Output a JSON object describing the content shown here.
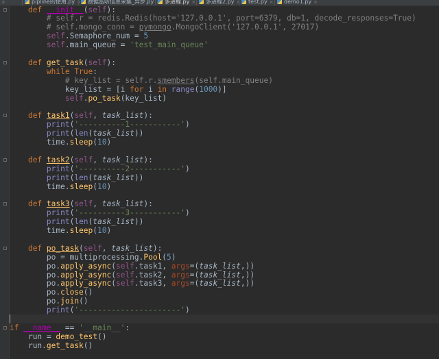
{
  "tabs": [
    {
      "label": "ly",
      "active": false
    },
    {
      "label": "pipline的使用.py",
      "active": false
    },
    {
      "label": "数据监听信息采集_异步.py",
      "active": false
    },
    {
      "label": "多进程.py",
      "active": true
    },
    {
      "label": "多进程2.py",
      "active": false
    },
    {
      "label": "test.py",
      "active": false
    },
    {
      "label": "demo1.py",
      "active": false
    }
  ],
  "tab_close_glyph": "×",
  "code_lines": [
    {
      "indent": "    ",
      "tokens": [
        [
          "kw",
          "def "
        ],
        [
          "magicu",
          "__init__"
        ],
        [
          "plain",
          "("
        ],
        [
          "self",
          "self"
        ],
        [
          "plain",
          "):"
        ]
      ]
    },
    {
      "indent": "        ",
      "tokens": [
        [
          "com",
          "# self.r = redis.Redis(host='127.0.0.1', port=6379, db=1, decode_responses=True)"
        ]
      ]
    },
    {
      "indent": "        ",
      "tokens": [
        [
          "com",
          "# self.mongo_conn = "
        ],
        [
          "comu",
          "pymongo"
        ],
        [
          "com",
          ".MongoClient('127.0.0.1', 27017)"
        ]
      ]
    },
    {
      "indent": "        ",
      "tokens": [
        [
          "self",
          "self"
        ],
        [
          "plain",
          ".Semaphore_num = "
        ],
        [
          "num",
          "5"
        ]
      ]
    },
    {
      "indent": "        ",
      "tokens": [
        [
          "self",
          "self"
        ],
        [
          "plain",
          ".main_queue = "
        ],
        [
          "str",
          "'test_main_queue'"
        ]
      ]
    },
    {
      "indent": "",
      "tokens": []
    },
    {
      "indent": "    ",
      "tokens": [
        [
          "kw",
          "def "
        ],
        [
          "fn",
          "get_task"
        ],
        [
          "plain",
          "("
        ],
        [
          "self",
          "self"
        ],
        [
          "plain",
          "):"
        ]
      ]
    },
    {
      "indent": "        ",
      "tokens": [
        [
          "kw",
          "while "
        ],
        [
          "kw",
          "True"
        ],
        [
          "plain",
          ":"
        ]
      ]
    },
    {
      "indent": "            ",
      "tokens": [
        [
          "com",
          "# key_list = self.r."
        ],
        [
          "comu",
          "smembers"
        ],
        [
          "com",
          "(self.main_queue)"
        ]
      ]
    },
    {
      "indent": "            ",
      "tokens": [
        [
          "plain",
          "key_list = [i "
        ],
        [
          "kw",
          "for "
        ],
        [
          "plain",
          "i "
        ],
        [
          "kw",
          "in "
        ],
        [
          "bi",
          "range"
        ],
        [
          "plain",
          "("
        ],
        [
          "num",
          "1000"
        ],
        [
          "plain",
          ")]"
        ]
      ]
    },
    {
      "indent": "            ",
      "tokens": [
        [
          "self",
          "self"
        ],
        [
          "plain",
          "."
        ],
        [
          "fn",
          "po_task"
        ],
        [
          "plain",
          "(key_list)"
        ]
      ]
    },
    {
      "indent": "",
      "tokens": []
    },
    {
      "indent": "    ",
      "tokens": [
        [
          "kw",
          "def "
        ],
        [
          "fnu",
          "task1"
        ],
        [
          "plain",
          "("
        ],
        [
          "self",
          "self"
        ],
        [
          "plain",
          ", "
        ],
        [
          "param",
          "task_list"
        ],
        [
          "plain",
          "):"
        ]
      ]
    },
    {
      "indent": "        ",
      "tokens": [
        [
          "bi",
          "print"
        ],
        [
          "plain",
          "("
        ],
        [
          "str",
          "'----------1-----------'"
        ],
        [
          "plain",
          ")"
        ]
      ]
    },
    {
      "indent": "        ",
      "tokens": [
        [
          "bi",
          "print"
        ],
        [
          "plain",
          "("
        ],
        [
          "bi",
          "len"
        ],
        [
          "plain",
          "("
        ],
        [
          "param",
          "task_list"
        ],
        [
          "plain",
          "))"
        ]
      ]
    },
    {
      "indent": "        ",
      "tokens": [
        [
          "plain",
          "time."
        ],
        [
          "fn",
          "sleep"
        ],
        [
          "plain",
          "("
        ],
        [
          "num",
          "10"
        ],
        [
          "plain",
          ")"
        ]
      ]
    },
    {
      "indent": "",
      "tokens": []
    },
    {
      "indent": "    ",
      "tokens": [
        [
          "kw",
          "def "
        ],
        [
          "fnu",
          "task2"
        ],
        [
          "plain",
          "("
        ],
        [
          "self",
          "self"
        ],
        [
          "plain",
          ", "
        ],
        [
          "param",
          "task_list"
        ],
        [
          "plain",
          "):"
        ]
      ]
    },
    {
      "indent": "        ",
      "tokens": [
        [
          "bi",
          "print"
        ],
        [
          "plain",
          "("
        ],
        [
          "str",
          "'----------2-----------'"
        ],
        [
          "plain",
          ")"
        ]
      ]
    },
    {
      "indent": "        ",
      "tokens": [
        [
          "bi",
          "print"
        ],
        [
          "plain",
          "("
        ],
        [
          "bi",
          "len"
        ],
        [
          "plain",
          "("
        ],
        [
          "param",
          "task_list"
        ],
        [
          "plain",
          "))"
        ]
      ]
    },
    {
      "indent": "        ",
      "tokens": [
        [
          "plain",
          "time."
        ],
        [
          "fn",
          "sleep"
        ],
        [
          "plain",
          "("
        ],
        [
          "num",
          "10"
        ],
        [
          "plain",
          ")"
        ]
      ]
    },
    {
      "indent": "",
      "tokens": []
    },
    {
      "indent": "    ",
      "tokens": [
        [
          "kw",
          "def "
        ],
        [
          "fnu",
          "task3"
        ],
        [
          "plain",
          "("
        ],
        [
          "self",
          "self"
        ],
        [
          "plain",
          ", "
        ],
        [
          "param",
          "task_list"
        ],
        [
          "plain",
          "):"
        ]
      ]
    },
    {
      "indent": "        ",
      "tokens": [
        [
          "bi",
          "print"
        ],
        [
          "plain",
          "("
        ],
        [
          "str",
          "'----------3-----------'"
        ],
        [
          "plain",
          ")"
        ]
      ]
    },
    {
      "indent": "        ",
      "tokens": [
        [
          "bi",
          "print"
        ],
        [
          "plain",
          "("
        ],
        [
          "bi",
          "len"
        ],
        [
          "plain",
          "("
        ],
        [
          "param",
          "task_list"
        ],
        [
          "plain",
          "))"
        ]
      ]
    },
    {
      "indent": "        ",
      "tokens": [
        [
          "plain",
          "time."
        ],
        [
          "fn",
          "sleep"
        ],
        [
          "plain",
          "("
        ],
        [
          "num",
          "10"
        ],
        [
          "plain",
          ")"
        ]
      ]
    },
    {
      "indent": "",
      "tokens": []
    },
    {
      "indent": "    ",
      "tokens": [
        [
          "kw",
          "def "
        ],
        [
          "fnu",
          "po_task"
        ],
        [
          "plain",
          "("
        ],
        [
          "self",
          "self"
        ],
        [
          "plain",
          ", "
        ],
        [
          "param",
          "task_list"
        ],
        [
          "plain",
          "):"
        ]
      ]
    },
    {
      "indent": "        ",
      "tokens": [
        [
          "plain",
          "po = multiprocessing."
        ],
        [
          "fn",
          "Pool"
        ],
        [
          "plain",
          "("
        ],
        [
          "num",
          "5"
        ],
        [
          "plain",
          ")"
        ]
      ]
    },
    {
      "indent": "        ",
      "tokens": [
        [
          "plain",
          "po."
        ],
        [
          "fn",
          "apply_async"
        ],
        [
          "plain",
          "("
        ],
        [
          "self",
          "self"
        ],
        [
          "plain",
          ".task1, "
        ],
        [
          "kwarg",
          "args"
        ],
        [
          "plain",
          "=("
        ],
        [
          "param",
          "task_list"
        ],
        [
          "plain",
          ","
        ],
        [
          "plain",
          "))"
        ]
      ]
    },
    {
      "indent": "        ",
      "tokens": [
        [
          "plain",
          "po."
        ],
        [
          "fn",
          "apply_async"
        ],
        [
          "plain",
          "("
        ],
        [
          "self",
          "self"
        ],
        [
          "plain",
          ".task2, "
        ],
        [
          "kwarg",
          "args"
        ],
        [
          "plain",
          "=("
        ],
        [
          "param",
          "task_list"
        ],
        [
          "plain",
          ","
        ],
        [
          "plain",
          "))"
        ]
      ]
    },
    {
      "indent": "        ",
      "tokens": [
        [
          "plain",
          "po."
        ],
        [
          "fn",
          "apply_async"
        ],
        [
          "plain",
          "("
        ],
        [
          "self",
          "self"
        ],
        [
          "plain",
          ".task3, "
        ],
        [
          "kwarg",
          "args"
        ],
        [
          "plain",
          "=("
        ],
        [
          "param",
          "task_list"
        ],
        [
          "plain",
          ","
        ],
        [
          "plain",
          "))"
        ]
      ]
    },
    {
      "indent": "        ",
      "tokens": [
        [
          "plain",
          "po."
        ],
        [
          "fn",
          "close"
        ],
        [
          "plain",
          "()"
        ]
      ]
    },
    {
      "indent": "        ",
      "tokens": [
        [
          "plain",
          "po."
        ],
        [
          "fn",
          "join"
        ],
        [
          "plain",
          "()"
        ]
      ]
    },
    {
      "indent": "        ",
      "tokens": [
        [
          "bi",
          "print"
        ],
        [
          "plain",
          "("
        ],
        [
          "str",
          "'----------------------'"
        ],
        [
          "plain",
          ")"
        ]
      ]
    },
    {
      "indent": "",
      "tokens": []
    },
    {
      "indent": "",
      "tokens": [
        [
          "kw",
          "if "
        ],
        [
          "magicu",
          "__name__"
        ],
        [
          "plain",
          " == "
        ],
        [
          "str",
          "'__main__'"
        ],
        [
          "plain",
          ":"
        ]
      ]
    },
    {
      "indent": "    ",
      "tokens": [
        [
          "plain",
          "run = "
        ],
        [
          "fn",
          "demo_test"
        ],
        [
          "plain",
          "()"
        ]
      ]
    },
    {
      "indent": "    ",
      "tokens": [
        [
          "plain",
          "run."
        ],
        [
          "fn",
          "get_task"
        ],
        [
          "plain",
          "()"
        ]
      ]
    }
  ],
  "colors": {
    "background": "#2b2b2b",
    "keyword": "#cc7832",
    "function": "#ffc66d",
    "string": "#6a8759",
    "number": "#6897bb",
    "comment": "#808080",
    "self": "#94558d",
    "builtin": "#8888c6"
  }
}
